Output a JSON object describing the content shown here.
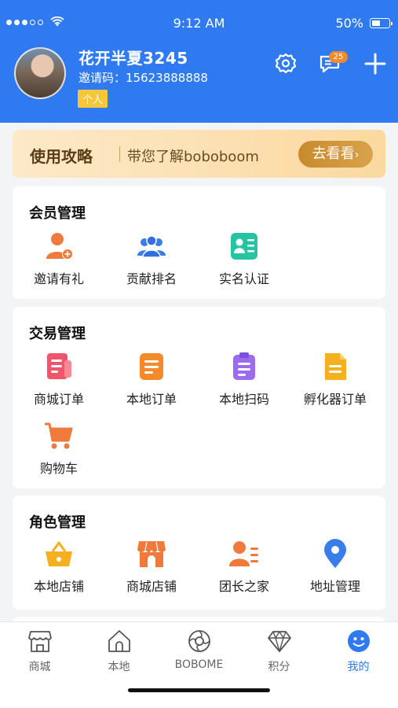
{
  "status_bar": {
    "time": "9:12 AM",
    "battery": "50%"
  },
  "profile": {
    "username": "花开半夏3245",
    "invite_code": "邀请码：15623888888",
    "tag": "个人",
    "message_badge": "25"
  },
  "banner": {
    "title": "使用攻略",
    "subtitle": "带您了解boboboom",
    "button": "去看看"
  },
  "sections": {
    "member": {
      "title": "会员管理",
      "items": [
        {
          "label": "邀请有礼",
          "icon": "invite-user-icon"
        },
        {
          "label": "贡献排名",
          "icon": "ranking-users-icon"
        },
        {
          "label": "实名认证",
          "icon": "id-card-icon"
        }
      ]
    },
    "trade": {
      "title": "交易管理",
      "items": [
        {
          "label": "商城订单",
          "icon": "mall-order-icon"
        },
        {
          "label": "本地订单",
          "icon": "local-order-icon"
        },
        {
          "label": "本地扫码",
          "icon": "scan-clipboard-icon"
        },
        {
          "label": "孵化器订单",
          "icon": "incubator-order-icon"
        },
        {
          "label": "购物车",
          "icon": "cart-icon"
        }
      ]
    },
    "role": {
      "title": "角色管理",
      "items": [
        {
          "label": "本地店铺",
          "icon": "basket-icon"
        },
        {
          "label": "商城店铺",
          "icon": "store-icon"
        },
        {
          "label": "团长之家",
          "icon": "leader-icon"
        },
        {
          "label": "地址管理",
          "icon": "location-pin-icon"
        }
      ]
    }
  },
  "tabbar": [
    {
      "label": "商城",
      "icon": "shop-icon",
      "active": false
    },
    {
      "label": "本地",
      "icon": "home-icon",
      "active": false
    },
    {
      "label": "BOBOME",
      "icon": "bobome-icon",
      "active": false
    },
    {
      "label": "积分",
      "icon": "diamond-icon",
      "active": false
    },
    {
      "label": "我的",
      "icon": "smile-icon",
      "active": true
    }
  ],
  "colors": {
    "primary": "#2f7af0",
    "banner_button": "#c98a2d",
    "orange": "#f07a3c",
    "blue_icon": "#3b7de8",
    "teal": "#27c4a4",
    "pink": "#f0566b",
    "amber": "#f4b01e",
    "purple": "#9b6cf0"
  }
}
